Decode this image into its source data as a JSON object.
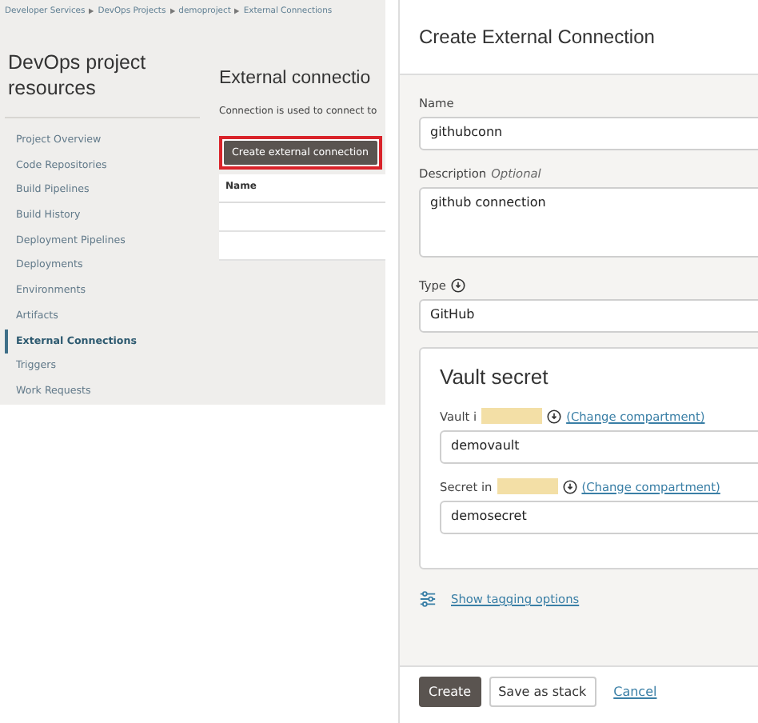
{
  "breadcrumb": [
    "Developer Services",
    "DevOps Projects",
    "demoproject",
    "External Connections"
  ],
  "sidebar": {
    "title": "DevOps project resources",
    "items": [
      {
        "label": "Project Overview",
        "selected": false
      },
      {
        "label": "Code Repositories",
        "selected": false
      },
      {
        "label": "Build Pipelines",
        "selected": false
      },
      {
        "label": "Build History",
        "selected": false
      },
      {
        "label": "Deployment Pipelines",
        "selected": false
      },
      {
        "label": "Deployments",
        "selected": false
      },
      {
        "label": "Environments",
        "selected": false
      },
      {
        "label": "Artifacts",
        "selected": false
      },
      {
        "label": "External Connections",
        "selected": true
      },
      {
        "label": "Triggers",
        "selected": false
      },
      {
        "label": "Work Requests",
        "selected": false
      }
    ]
  },
  "main": {
    "heading": "External connectio",
    "description": "Connection is used to connect to",
    "create_button": "Create external connection",
    "table": {
      "columns": [
        "Name"
      ]
    }
  },
  "panel": {
    "title": "Create External Connection",
    "name": {
      "label": "Name",
      "value": "githubconn"
    },
    "description": {
      "label": "Description",
      "optional": "Optional",
      "value": "github connection"
    },
    "type": {
      "label": "Type",
      "value": "GitHub"
    },
    "vault_section": {
      "title": "Vault secret",
      "vault": {
        "label": "Vault i",
        "link": "(Change compartment)",
        "value": "demovault"
      },
      "secret": {
        "label": "Secret in",
        "link": "(Change compartment)",
        "value": "demosecret"
      }
    },
    "tagging_link": "Show tagging options",
    "buttons": {
      "create": "Create",
      "save_stack": "Save as stack",
      "cancel": "Cancel"
    }
  }
}
